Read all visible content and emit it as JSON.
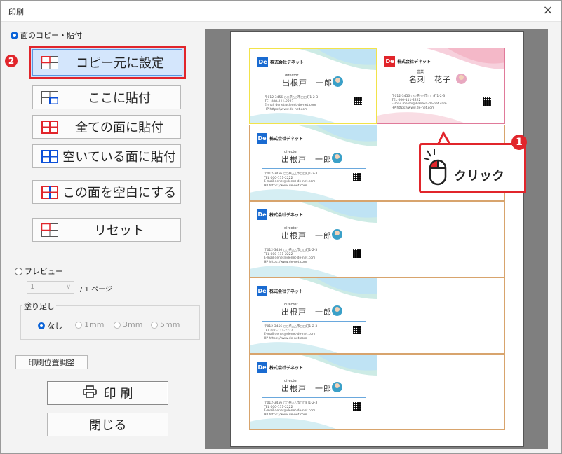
{
  "window": {
    "title": "印刷",
    "close_glyph": "×"
  },
  "mode_radio_paste": {
    "label": "面のコピー・貼付",
    "selected": true
  },
  "buttons": {
    "copy_source": "コピー元に設定",
    "paste_here": "ここに貼付",
    "paste_all": "全ての面に貼付",
    "paste_empty": "空いている面に貼付",
    "make_blank": "この面を空白にする",
    "reset": "リセット"
  },
  "mode_radio_preview": {
    "label": "プレビュー",
    "selected": false
  },
  "page_select": {
    "value": "1",
    "total": "/ 1 ページ"
  },
  "bleed": {
    "label": "塗り足し",
    "options": [
      {
        "label": "なし",
        "selected": true
      },
      {
        "label": "1mm",
        "selected": false
      },
      {
        "label": "3mm",
        "selected": false
      },
      {
        "label": "5mm",
        "selected": false
      }
    ]
  },
  "adjust_button": "印刷位置調整",
  "print_button": "印 刷",
  "close_button": "閉じる",
  "badges": {
    "step1": "1",
    "step2": "2"
  },
  "callout": {
    "text": "クリック"
  },
  "card_blue": {
    "logo": "De",
    "company": "株式会社デネット",
    "role": "director",
    "name": "出根戸　一郎",
    "addr1": "〒012-3456 ○○県△△市□□町1-2-3",
    "addr2": "TEL 000-111-2222",
    "addr3": "E-mail denet@denet-de-net.com",
    "addr4": "HP https://www.de-net.com"
  },
  "card_red": {
    "logo": "De",
    "company": "株式会社デネット",
    "role": "営業",
    "name": "名刺　花子",
    "addr1": "〒012-3456 ○○県△△市□□町1-2-3",
    "addr2": "TEL 000-111-2222",
    "addr3": "E-mail meishi@hanako-de-net.com",
    "addr4": "HP https://www.de-net.com"
  },
  "colors": {
    "accent_red": "#e1252b",
    "accent_blue": "#0b63d8",
    "copy_border": "#f2e34a",
    "slot_border": "#d8a46d"
  }
}
